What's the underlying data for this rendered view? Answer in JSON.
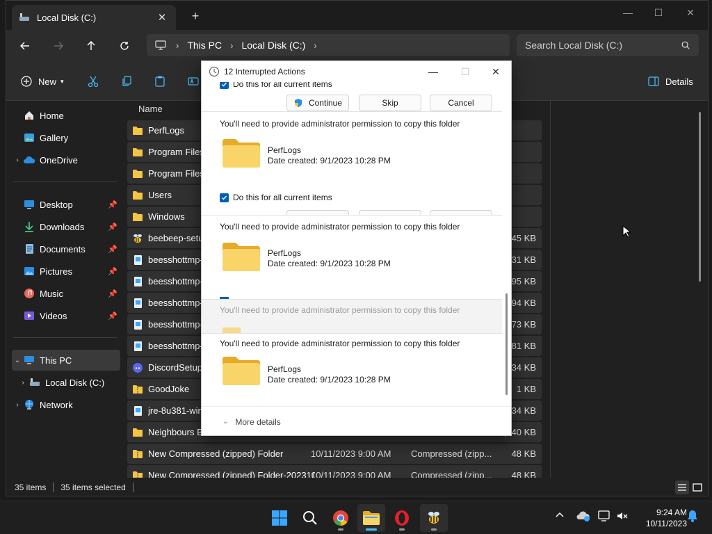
{
  "explorer": {
    "tab_title": "Local Disk (C:)",
    "address": {
      "crumbs": [
        "This PC",
        "Local Disk (C:)"
      ]
    },
    "search_placeholder": "Search Local Disk (C:)",
    "commandbar": {
      "new_label": "New",
      "details_label": "Details"
    },
    "navpane": {
      "home": "Home",
      "gallery": "Gallery",
      "onedrive": "OneDrive",
      "desktop": "Desktop",
      "downloads": "Downloads",
      "documents": "Documents",
      "pictures": "Pictures",
      "music": "Music",
      "videos": "Videos",
      "thispc": "This PC",
      "localdisk": "Local Disk (C:)",
      "network": "Network"
    },
    "column_name": "Name",
    "files": [
      {
        "name": "PerfLogs",
        "date": "",
        "type": "",
        "size": ""
      },
      {
        "name": "Program Files",
        "date": "",
        "type": "",
        "size": ""
      },
      {
        "name": "Program Files (x",
        "date": "",
        "type": "",
        "size": ""
      },
      {
        "name": "Users",
        "date": "",
        "type": "",
        "size": ""
      },
      {
        "name": "Windows",
        "date": "",
        "type": "",
        "size": ""
      },
      {
        "name": "beebeep-setup-",
        "date": "",
        "type": "",
        "size": ",545 KB"
      },
      {
        "name": "beesshottmp-20",
        "date": "",
        "type": "",
        "size": "231 KB"
      },
      {
        "name": "beesshottmp-20",
        "date": "",
        "type": "",
        "size": "95 KB"
      },
      {
        "name": "beesshottmp-20",
        "date": "",
        "type": "",
        "size": "94 KB"
      },
      {
        "name": "beesshottmp-20",
        "date": "",
        "type": "",
        "size": "73 KB"
      },
      {
        "name": "beesshottmp-20",
        "date": "",
        "type": "",
        "size": "81 KB"
      },
      {
        "name": "DiscordSetup",
        "date": "",
        "type": "",
        "size": ",534 KB"
      },
      {
        "name": "GoodJoke",
        "date": "",
        "type": "",
        "size": "1 KB"
      },
      {
        "name": "jre-8u381-winde",
        "date": "",
        "type": "",
        "size": ",134 KB"
      },
      {
        "name": "Neighbours Bac",
        "date": "",
        "type": "",
        "size": ",340 KB"
      },
      {
        "name": "New Compressed (zipped) Folder",
        "date": "10/11/2023 9:00 AM",
        "type": "Compressed (zipp...",
        "size": "48 KB"
      },
      {
        "name": "New Compressed (zipped) Folder-202310...",
        "date": "10/11/2023 9:00 AM",
        "type": "Compressed (zipp...",
        "size": "48 KB"
      }
    ],
    "status": {
      "items": "35 items",
      "selected": "35 items selected"
    }
  },
  "dialog": {
    "title": "12 Interrupted Actions",
    "check_label": "Do this for all current items",
    "buttons": {
      "continue": "Continue",
      "skip": "Skip",
      "cancel": "Cancel"
    },
    "message": "You'll need to provide administrator permission to copy this folder",
    "folder_name": "PerfLogs",
    "folder_date": "Date created: 9/1/2023 10:28 PM",
    "more_details": "More details"
  },
  "taskbar": {
    "time": "9:24 AM",
    "date": "10/11/2023"
  },
  "colors": {
    "accent": "#005fb8",
    "folder": "#f6c443",
    "taskbar_indicator": "#4cc2ff"
  }
}
